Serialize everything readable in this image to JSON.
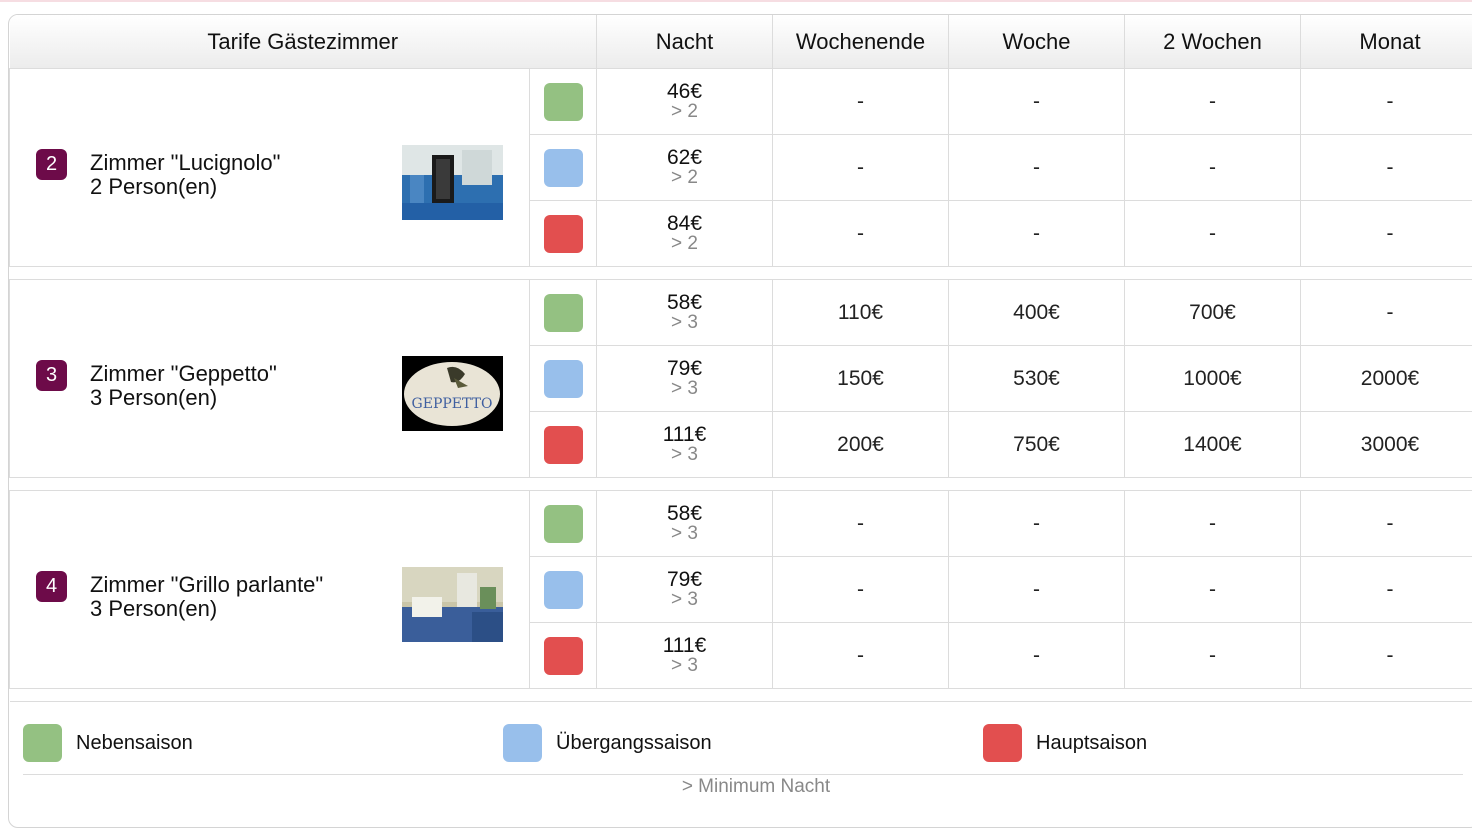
{
  "header": {
    "title": "Tarife Gästezimmer",
    "columns": [
      "Nacht",
      "Wochenende",
      "Woche",
      "2 Wochen",
      "Monat"
    ]
  },
  "seasons": [
    {
      "name": "Nebensaison",
      "color": "#94c182"
    },
    {
      "name": "Übergangssaison",
      "color": "#98bfeb"
    },
    {
      "name": "Hauptsaison",
      "color": "#e24f4f"
    }
  ],
  "rooms": [
    {
      "number": "2",
      "name": "Zimmer \"Lucignolo\"",
      "capacity": "2 Person(en)",
      "photo": "room-photo-lucignolo",
      "rates": [
        {
          "season": "Nebensaison",
          "night": "46€",
          "min": "> 2",
          "weekend": "-",
          "week": "-",
          "two_weeks": "-",
          "month": "-"
        },
        {
          "season": "Übergangssaison",
          "night": "62€",
          "min": "> 2",
          "weekend": "-",
          "week": "-",
          "two_weeks": "-",
          "month": "-"
        },
        {
          "season": "Hauptsaison",
          "night": "84€",
          "min": "> 2",
          "weekend": "-",
          "week": "-",
          "two_weeks": "-",
          "month": "-"
        }
      ]
    },
    {
      "number": "3",
      "name": "Zimmer \"Geppetto\"",
      "capacity": "3 Person(en)",
      "photo": "room-photo-geppetto",
      "rates": [
        {
          "season": "Nebensaison",
          "night": "58€",
          "min": "> 3",
          "weekend": "110€",
          "week": "400€",
          "two_weeks": "700€",
          "month": "-"
        },
        {
          "season": "Übergangssaison",
          "night": "79€",
          "min": "> 3",
          "weekend": "150€",
          "week": "530€",
          "two_weeks": "1000€",
          "month": "2000€"
        },
        {
          "season": "Hauptsaison",
          "night": "111€",
          "min": "> 3",
          "weekend": "200€",
          "week": "750€",
          "two_weeks": "1400€",
          "month": "3000€"
        }
      ]
    },
    {
      "number": "4",
      "name": "Zimmer \"Grillo parlante\"",
      "capacity": "3 Person(en)",
      "photo": "room-photo-grillo-parlante",
      "rates": [
        {
          "season": "Nebensaison",
          "night": "58€",
          "min": "> 3",
          "weekend": "-",
          "week": "-",
          "two_weeks": "-",
          "month": "-"
        },
        {
          "season": "Übergangssaison",
          "night": "79€",
          "min": "> 3",
          "weekend": "-",
          "week": "-",
          "two_weeks": "-",
          "month": "-"
        },
        {
          "season": "Hauptsaison",
          "night": "111€",
          "min": "> 3",
          "weekend": "-",
          "week": "-",
          "two_weeks": "-",
          "month": "-"
        }
      ]
    }
  ],
  "footer": {
    "note": "> Minimum Nacht"
  }
}
